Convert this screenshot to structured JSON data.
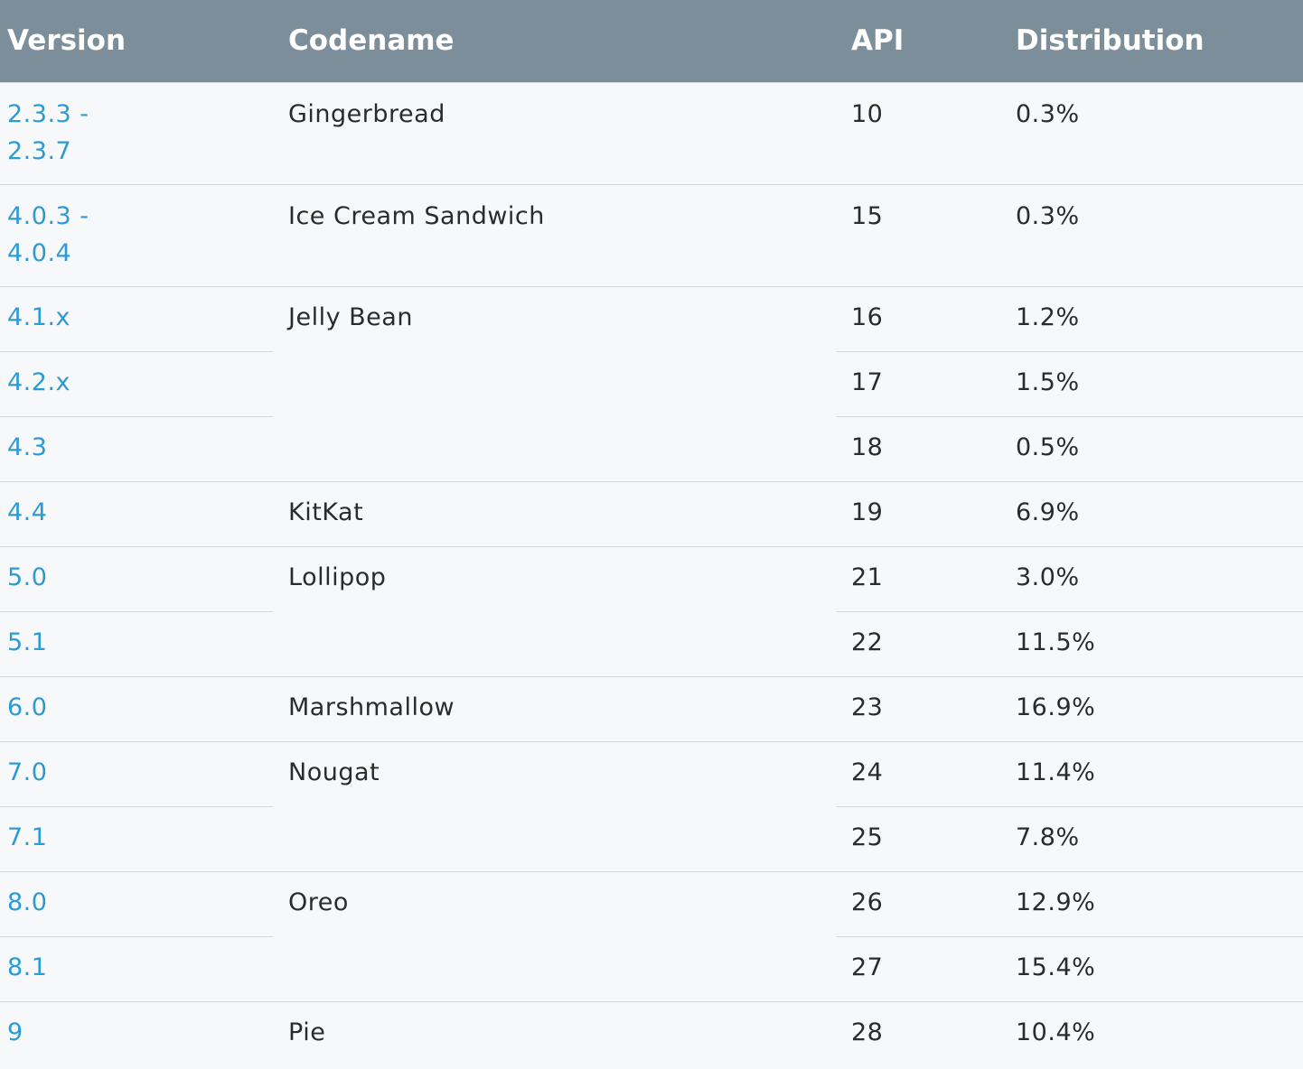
{
  "table": {
    "headers": {
      "version": "Version",
      "codename": "Codename",
      "api": "API",
      "distribution": "Distribution"
    },
    "groups": [
      {
        "codename": "Gingerbread",
        "rows": [
          {
            "version_line1": "2.3.3 -",
            "version_line2": "2.3.7",
            "api": "10",
            "distribution": "0.3%"
          }
        ]
      },
      {
        "codename": "Ice Cream Sandwich",
        "rows": [
          {
            "version_line1": "4.0.3 -",
            "version_line2": "4.0.4",
            "api": "15",
            "distribution": "0.3%"
          }
        ]
      },
      {
        "codename": "Jelly Bean",
        "rows": [
          {
            "version": "4.1.x",
            "api": "16",
            "distribution": "1.2%"
          },
          {
            "version": "4.2.x",
            "api": "17",
            "distribution": "1.5%"
          },
          {
            "version": "4.3",
            "api": "18",
            "distribution": "0.5%"
          }
        ]
      },
      {
        "codename": "KitKat",
        "rows": [
          {
            "version": "4.4",
            "api": "19",
            "distribution": "6.9%"
          }
        ]
      },
      {
        "codename": "Lollipop",
        "rows": [
          {
            "version": "5.0",
            "api": "21",
            "distribution": "3.0%"
          },
          {
            "version": "5.1",
            "api": "22",
            "distribution": "11.5%"
          }
        ]
      },
      {
        "codename": "Marshmallow",
        "rows": [
          {
            "version": "6.0",
            "api": "23",
            "distribution": "16.9%"
          }
        ]
      },
      {
        "codename": "Nougat",
        "rows": [
          {
            "version": "7.0",
            "api": "24",
            "distribution": "11.4%"
          },
          {
            "version": "7.1",
            "api": "25",
            "distribution": "7.8%"
          }
        ]
      },
      {
        "codename": "Oreo",
        "rows": [
          {
            "version": "8.0",
            "api": "26",
            "distribution": "12.9%"
          },
          {
            "version": "8.1",
            "api": "27",
            "distribution": "15.4%"
          }
        ]
      },
      {
        "codename": "Pie",
        "rows": [
          {
            "version": "9",
            "api": "28",
            "distribution": "10.4%"
          }
        ]
      }
    ]
  },
  "colors": {
    "header_bg": "#7b8e9a",
    "header_text": "#ffffff",
    "link": "#2c9bd3",
    "body_text": "#2b2b2b",
    "row_bg": "#f7f8fa",
    "divider": "#d6d9dc"
  }
}
